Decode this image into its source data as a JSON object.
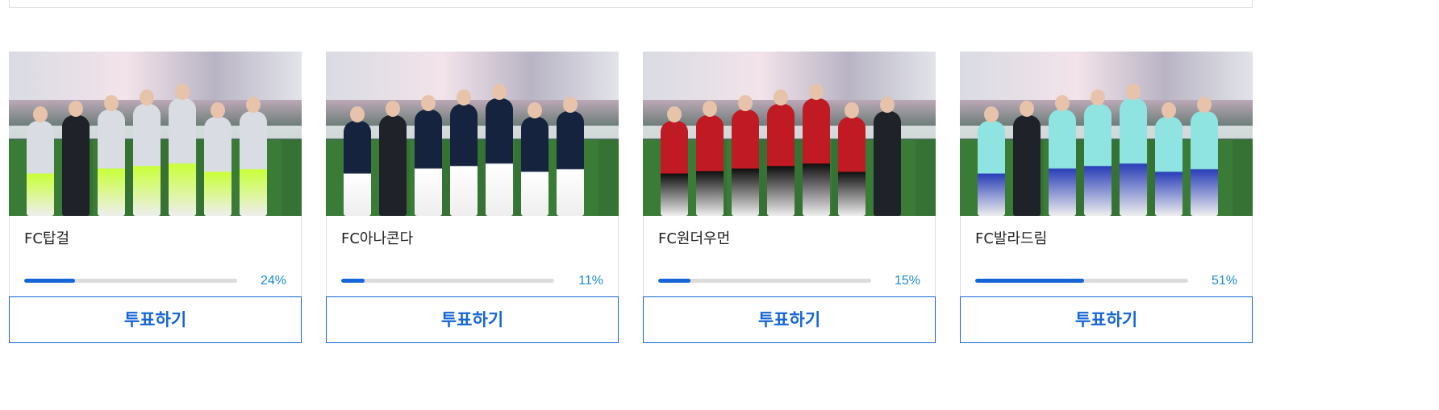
{
  "cards": [
    {
      "team": "FC탑걸",
      "percent_label": "24%",
      "percent": 24,
      "vote_label": "투표하기",
      "jersey_color": "#d9dde3",
      "accent_color": "#c9ff3a",
      "suit_present": true
    },
    {
      "team": "FC아나콘다",
      "percent_label": "11%",
      "percent": 11,
      "vote_label": "투표하기",
      "jersey_color": "#15233f",
      "accent_color": "#ffffff",
      "suit_present": true
    },
    {
      "team": "FC원더우먼",
      "percent_label": "15%",
      "percent": 15,
      "vote_label": "투표하기",
      "jersey_color": "#c01a24",
      "accent_color": "#111111",
      "suit_present": true
    },
    {
      "team": "FC발라드림",
      "percent_label": "51%",
      "percent": 51,
      "vote_label": "투표하기",
      "jersey_color": "#8fe3e0",
      "accent_color": "#2b3fb8",
      "suit_present": true
    }
  ],
  "colors": {
    "accent": "#1565d8",
    "percent_text": "#1a8ad4",
    "track": "#dcdcdc"
  }
}
